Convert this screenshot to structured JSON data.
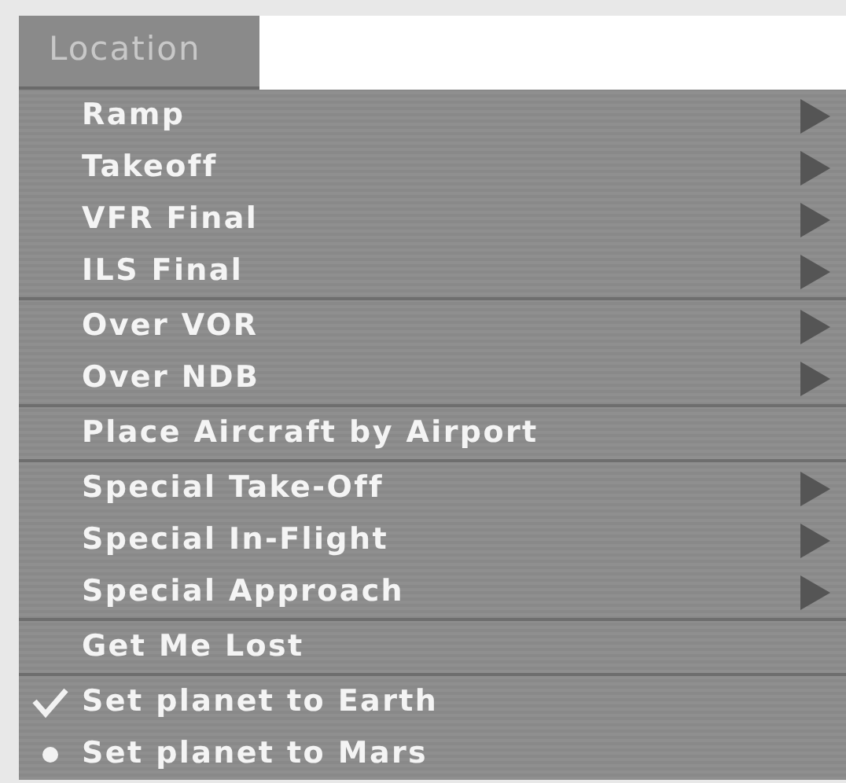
{
  "menu_title": "Location",
  "groups": [
    {
      "items": [
        {
          "label": "Ramp",
          "submenu": true
        },
        {
          "label": "Takeoff",
          "submenu": true
        },
        {
          "label": "VFR Final",
          "submenu": true
        },
        {
          "label": "ILS Final",
          "submenu": true
        }
      ]
    },
    {
      "items": [
        {
          "label": "Over VOR",
          "submenu": true
        },
        {
          "label": "Over NDB",
          "submenu": true
        }
      ]
    },
    {
      "items": [
        {
          "label": "Place Aircraft by Airport",
          "submenu": false
        }
      ]
    },
    {
      "items": [
        {
          "label": "Special Take-Off",
          "submenu": true
        },
        {
          "label": "Special In-Flight",
          "submenu": true
        },
        {
          "label": "Special Approach",
          "submenu": true
        }
      ]
    },
    {
      "items": [
        {
          "label": "Get Me Lost",
          "submenu": false
        }
      ]
    },
    {
      "items": [
        {
          "label": "Set planet to Earth",
          "submenu": false,
          "checked": true,
          "bullet": false
        },
        {
          "label": "Set planet to Mars",
          "submenu": false,
          "checked": false,
          "bullet": true
        }
      ]
    }
  ]
}
